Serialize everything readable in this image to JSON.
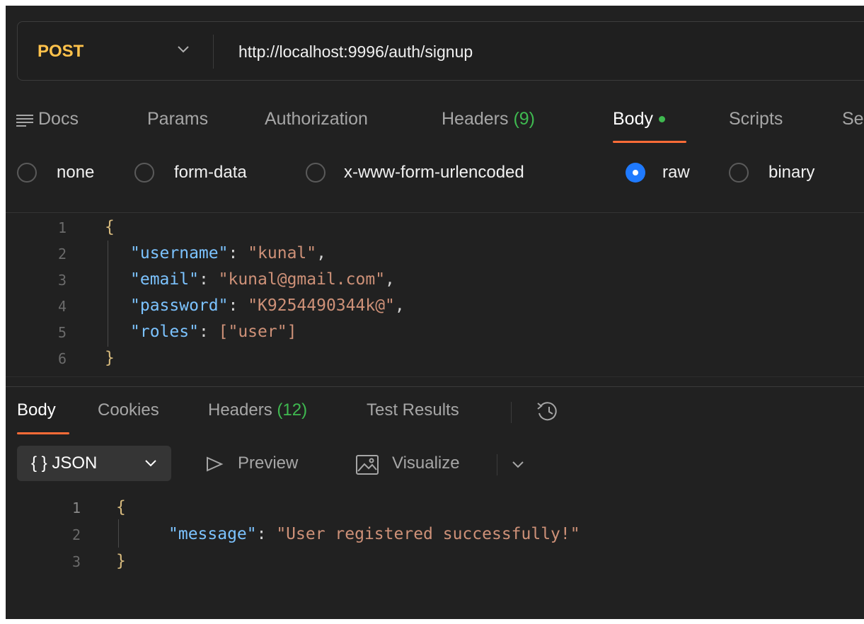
{
  "request": {
    "method": "POST",
    "url": "http://localhost:9996/auth/signup"
  },
  "request_tabs": {
    "docs": "Docs",
    "params": "Params",
    "authorization": "Authorization",
    "headers": "Headers",
    "headers_count": "(9)",
    "body": "Body",
    "scripts": "Scripts",
    "settings_partial": "Se"
  },
  "body_types": {
    "none": "none",
    "form_data": "form-data",
    "urlencoded": "x-www-form-urlencoded",
    "raw": "raw",
    "binary": "binary",
    "selected": "raw"
  },
  "request_body": {
    "line_numbers": [
      "1",
      "2",
      "3",
      "4",
      "5",
      "6"
    ],
    "open": "{",
    "close": "}",
    "fields": [
      {
        "key": "\"username\"",
        "value": "\"kunal\"",
        "trail": ","
      },
      {
        "key": "\"email\"",
        "value": "\"kunal@gmail.com\"",
        "trail": ","
      },
      {
        "key": "\"password\"",
        "value": "\"K9254490344k@\"",
        "trail": ","
      },
      {
        "key": "\"roles\"",
        "value": "[\"user\"]",
        "trail": ""
      }
    ]
  },
  "response_tabs": {
    "body": "Body",
    "cookies": "Cookies",
    "headers": "Headers",
    "headers_count": "(12)",
    "test_results": "Test Results"
  },
  "response_toolbar": {
    "format": "{ }  JSON",
    "preview": "Preview",
    "visualize": "Visualize"
  },
  "response_body": {
    "line_numbers": [
      "1",
      "2",
      "3"
    ],
    "open": "{",
    "close": "}",
    "key": "\"message\"",
    "value": "\"User registered successfully!\""
  },
  "colors": {
    "accent": "#ff6c37",
    "method": "#ffc24b",
    "success": "#3fb950",
    "radio_selected": "#1f7aff",
    "json_key": "#7cc3ff",
    "json_string": "#ce9178"
  }
}
